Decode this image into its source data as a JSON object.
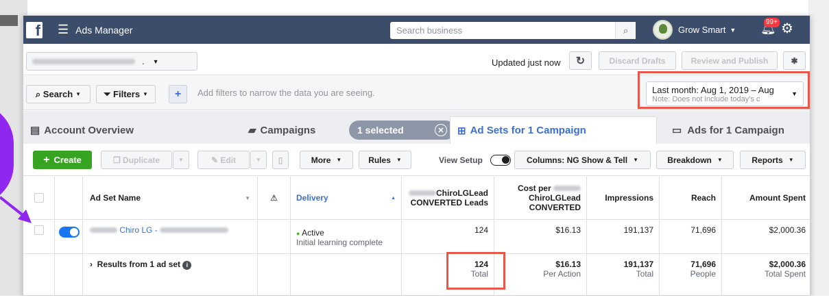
{
  "topbar": {
    "logo": "f",
    "app_title": "Ads Manager",
    "search_placeholder": "Search business",
    "account_name": "Grow Smart",
    "notif_count": "99+"
  },
  "row2": {
    "updated": "Updated just now",
    "discard": "Discard Drafts",
    "review": "Review and Publish"
  },
  "filters": {
    "search": "Search",
    "filters": "Filters",
    "hint": "Add filters to narrow the data you are seeing.",
    "date_line1": "Last month: Aug 1, 2019 – Aug",
    "date_line2": "Note: Does not include today's c"
  },
  "tabs": {
    "account": "Account Overview",
    "campaigns": "Campaigns",
    "selected": "1 selected",
    "adsets": "Ad Sets for 1 Campaign",
    "ads": "Ads for 1 Campaign"
  },
  "toolbar": {
    "create": "Create",
    "duplicate": "Duplicate",
    "edit": "Edit",
    "more": "More",
    "rules": "Rules",
    "view_setup": "View Setup",
    "columns": "Columns: NG Show & Tell",
    "breakdown": "Breakdown",
    "reports": "Reports"
  },
  "columns": {
    "name": "Ad Set Name",
    "delivery": "Delivery",
    "leads_1": "ChiroLGLead",
    "leads_2": "CONVERTED Leads",
    "cost_1": "Cost per",
    "cost_2": "ChiroLGLead",
    "cost_3": "CONVERTED",
    "impressions": "Impressions",
    "reach": "Reach",
    "spent": "Amount Spent"
  },
  "row": {
    "name": "Chiro LG -",
    "status": "Active",
    "status_sub": "Initial learning complete",
    "leads": "124",
    "cost": "$16.13",
    "impressions": "191,137",
    "reach": "71,696",
    "spent": "$2,000.36",
    "delivery_on": true
  },
  "total": {
    "label": "Results from 1 ad set",
    "leads": "124",
    "leads_sub": "Total",
    "cost": "$16.13",
    "cost_sub": "Per Action",
    "impressions": "191,137",
    "impressions_sub": "Total",
    "reach": "71,696",
    "reach_sub": "People",
    "spent": "$2,000.36",
    "spent_sub": "Total Spent"
  },
  "colors": {
    "topbar": "#3b4d6b",
    "highlight": "#e9574b",
    "accent": "#8f27ee",
    "create": "#36a420",
    "link": "#3b6fd4"
  }
}
